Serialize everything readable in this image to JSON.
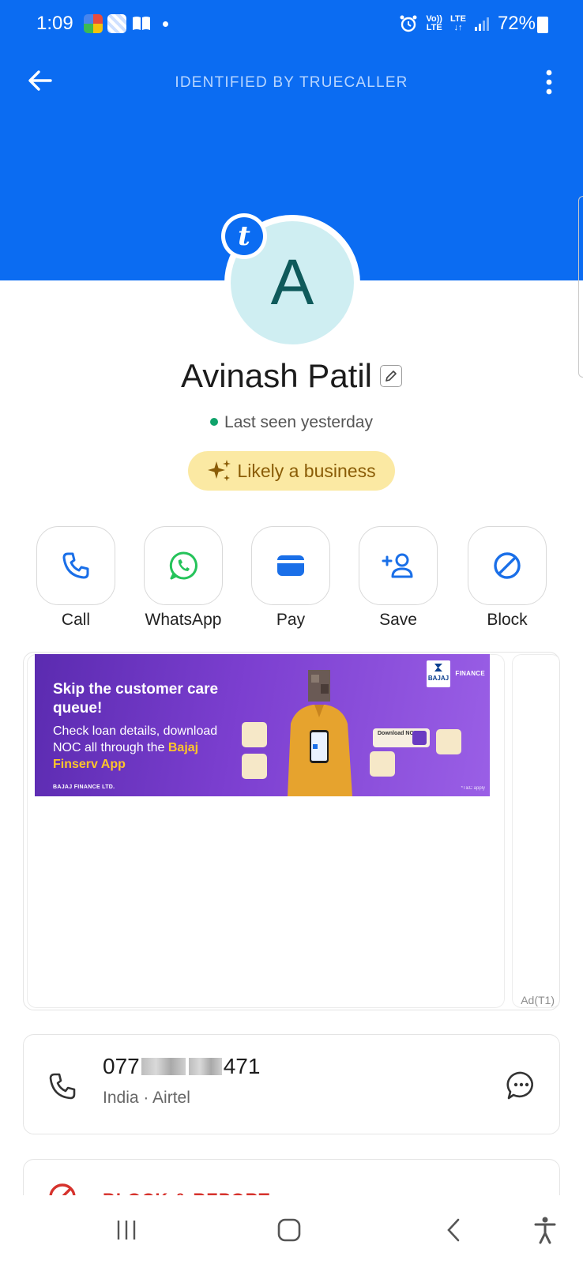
{
  "status_bar": {
    "time": "1:09",
    "network_top": "Vo))",
    "network_bottom": "LTE",
    "lte_top": "LTE",
    "lte_bottom": "↓↑",
    "battery": "72%"
  },
  "header": {
    "title": "IDENTIFIED BY TRUECALLER",
    "brand_color": "#0b6cf2"
  },
  "profile": {
    "avatar_letter": "A",
    "badge_letter": "t",
    "name": "Avinash Patil",
    "last_seen": "Last seen yesterday",
    "business_tag": "Likely a business"
  },
  "actions": [
    {
      "label": "Call",
      "icon": "phone-icon"
    },
    {
      "label": "WhatsApp",
      "icon": "whatsapp-icon"
    },
    {
      "label": "Pay",
      "icon": "wallet-icon"
    },
    {
      "label": "Save",
      "icon": "add-contact-icon"
    },
    {
      "label": "Block",
      "icon": "block-icon"
    }
  ],
  "ad": {
    "headline": "Skip the customer care queue!",
    "body_prefix": "Check loan details, download NOC all through the ",
    "body_highlight": "Bajaj Finserv App",
    "footer": "BAJAJ FINANCE LTD.",
    "terms": "*T&C apply",
    "logo_text": "FINANCE",
    "logo_sub": "BAJAJ",
    "download_label": "Download NOC",
    "ad_label": "Ad(T1)"
  },
  "phone": {
    "number_start": "077",
    "number_end": "471",
    "meta": "India · Airtel"
  },
  "report": {
    "label": "BLOCK & REPORT"
  }
}
